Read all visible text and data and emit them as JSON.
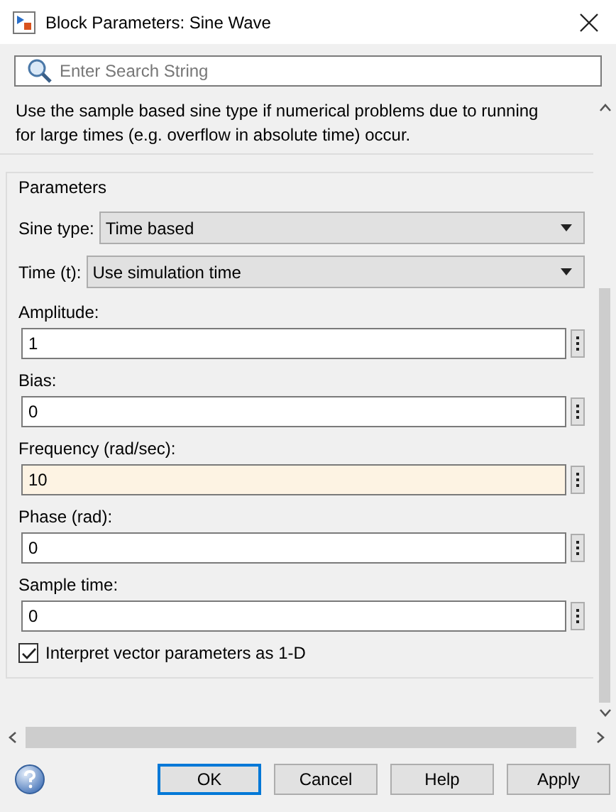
{
  "window": {
    "title": "Block Parameters: Sine Wave"
  },
  "search": {
    "placeholder": "Enter Search String"
  },
  "description": [
    "Use the sample based sine type if numerical problems due to running",
    "for large times (e.g. overflow in absolute time) occur."
  ],
  "parameters": {
    "title": "Parameters",
    "dropdowns": [
      {
        "label": "Sine type:",
        "value": "Time based"
      },
      {
        "label": "Time (t):",
        "value": "Use simulation time"
      }
    ],
    "fields": [
      {
        "label": "Amplitude:",
        "value": "1",
        "highlighted": false
      },
      {
        "label": "Bias:",
        "value": "0",
        "highlighted": false
      },
      {
        "label": "Frequency (rad/sec):",
        "value": "10",
        "highlighted": true
      },
      {
        "label": "Phase (rad):",
        "value": "0",
        "highlighted": false
      },
      {
        "label": "Sample time:",
        "value": "0",
        "highlighted": false
      }
    ],
    "checkbox": {
      "label": "Interpret vector parameters as 1-D",
      "checked": true
    }
  },
  "buttons": [
    {
      "label": "OK",
      "default": true
    },
    {
      "label": "Cancel",
      "default": false
    },
    {
      "label": "Help",
      "default": false
    },
    {
      "label": "Apply",
      "default": false
    }
  ]
}
